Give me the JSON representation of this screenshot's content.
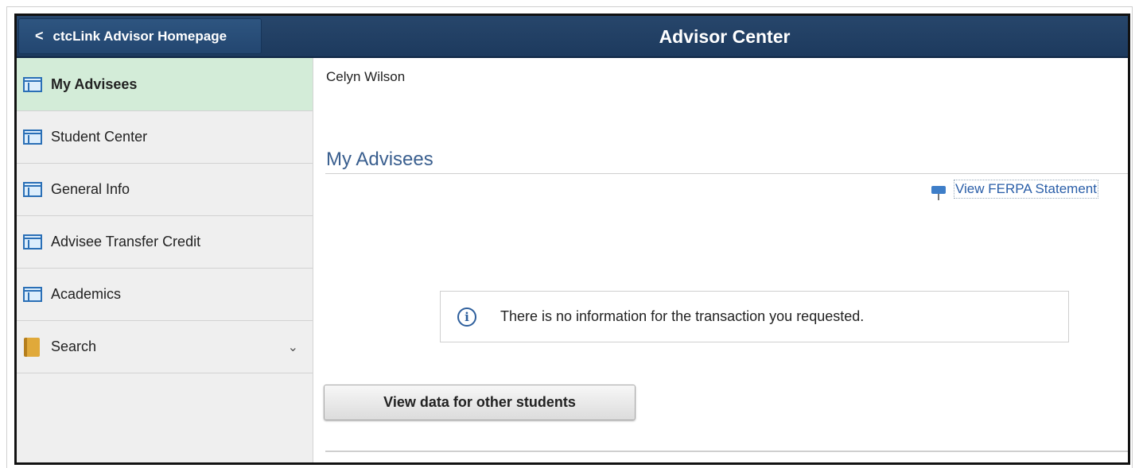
{
  "header": {
    "back_label": "ctcLink Advisor Homepage",
    "title": "Advisor Center"
  },
  "sidebar": {
    "items": [
      {
        "label": "My Advisees",
        "icon": "page-icon",
        "selected": true
      },
      {
        "label": "Student Center",
        "icon": "page-icon"
      },
      {
        "label": "General Info",
        "icon": "page-icon"
      },
      {
        "label": "Advisee Transfer Credit",
        "icon": "page-icon"
      },
      {
        "label": "Academics",
        "icon": "page-icon"
      },
      {
        "label": "Search",
        "icon": "folder-icon",
        "expandable": true
      }
    ]
  },
  "main": {
    "user_name": "Celyn Wilson",
    "section_title": "My Advisees",
    "ferpa_link": "View FERPA Statement",
    "info_message": "There is no information for the transaction you requested.",
    "view_button": "View data for other students"
  },
  "colors": {
    "banner": "#1d3a5e",
    "selected_item": "#d3ecd8",
    "link": "#2a5ea8",
    "section_title": "#3a5f8f"
  }
}
